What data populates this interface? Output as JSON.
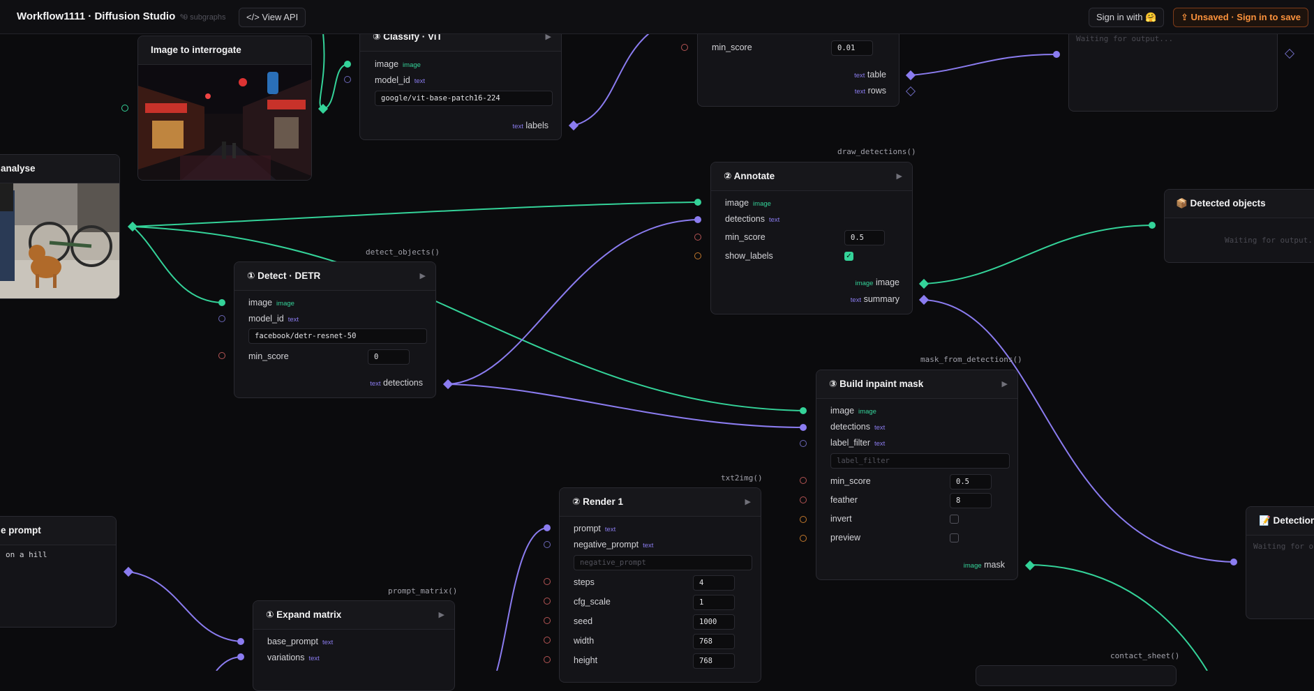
{
  "header": {
    "title": "Workflow1111 · Diffusion Studio",
    "subgraphs": "9 subgraphs",
    "view_api": "View API",
    "sign_in": "Sign in with 🤗",
    "save": "Unsaved · Sign in to save"
  },
  "tags": {
    "image": "image",
    "text": "text"
  },
  "run_glyph": "▶",
  "check_glyph": "✓",
  "nodes": {
    "image_interrogate": {
      "title": "Image to interrogate"
    },
    "classify": {
      "title": "③ Classify · ViT",
      "in_image": "image",
      "in_model": "model_id",
      "model_value": "google/vit-base-patch16-224",
      "out_labels": "labels"
    },
    "table_node": {
      "in_min_score": "min_score",
      "min_score_value": "0.01",
      "out_table": "table",
      "out_rows": "rows"
    },
    "top_output": {
      "waiting": "Waiting for output..."
    },
    "analyse": {
      "title": "analyse"
    },
    "annotate": {
      "fn": "draw_detections()",
      "title": "② Annotate",
      "in_image": "image",
      "in_detections": "detections",
      "in_min_score": "min_score",
      "min_score_value": "0.5",
      "in_show_labels": "show_labels",
      "out_image": "image",
      "out_summary": "summary"
    },
    "detected_objects": {
      "title": "📦 Detected objects",
      "waiting": "Waiting for output..."
    },
    "detect": {
      "fn": "detect_objects()",
      "title": "① Detect · DETR",
      "in_image": "image",
      "in_model": "model_id",
      "model_value": "facebook/detr-resnet-50",
      "in_min_score": "min_score",
      "min_score_value": "0",
      "out_detections": "detections"
    },
    "inpaint_mask": {
      "fn": "mask_from_detections()",
      "title": "③ Build inpaint mask",
      "in_image": "image",
      "in_detections": "detections",
      "in_label_filter": "label_filter",
      "label_filter_placeholder": "label_filter",
      "in_min_score": "min_score",
      "min_score_value": "0.5",
      "in_feather": "feather",
      "feather_value": "8",
      "in_invert": "invert",
      "in_preview": "preview",
      "out_mask": "mask"
    },
    "detection_right": {
      "title": "📝 Detection",
      "waiting": "Waiting for o"
    },
    "prompt_left": {
      "title": "e prompt",
      "value": "on a hill"
    },
    "render": {
      "fn": "txt2img()",
      "title": "② Render 1",
      "in_prompt": "prompt",
      "in_negative": "negative_prompt",
      "negative_placeholder": "negative_prompt",
      "in_steps": "steps",
      "steps_value": "4",
      "in_cfg": "cfg_scale",
      "cfg_value": "1",
      "in_seed": "seed",
      "seed_value": "1000",
      "in_width": "width",
      "width_value": "768",
      "in_height": "height",
      "height_value": "768"
    },
    "expand": {
      "fn": "prompt_matrix()",
      "title": "① Expand matrix",
      "in_base": "base_prompt",
      "in_variations": "variations"
    },
    "contact_sheet": {
      "fn": "contact_sheet()"
    }
  },
  "colors": {
    "image_wire": "#34d399",
    "text_wire": "#8b7cf0",
    "save_accent": "#fb923c"
  }
}
